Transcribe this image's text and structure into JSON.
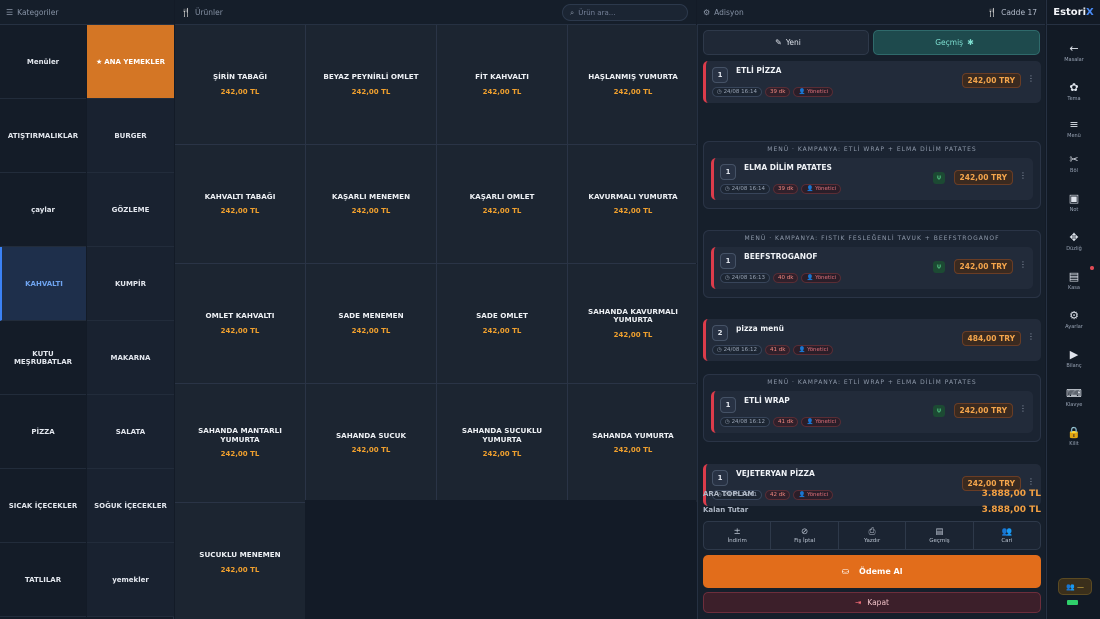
{
  "header": {
    "categories_title": "Kategoriler",
    "products_title": "Ürünler",
    "search_placeholder": "Ürün ara...",
    "cart_title": "Adisyon",
    "table_label": "Cadde 17"
  },
  "categories": [
    "Menüler",
    "ANA YEMEKLER",
    "ATIŞTIRMALIKLAR",
    "BURGER",
    "çaylar",
    "GÖZLEME",
    "KAHVALTI",
    "KUMPİR",
    "KUTU MEŞRUBATLAR",
    "MAKARNA",
    "PİZZA",
    "SALATA",
    "SICAK İÇECEKLER",
    "SOĞUK İÇECEKLER",
    "TATLILAR",
    "yemekler"
  ],
  "active_category": "KAHVALTI",
  "products": [
    {
      "name": "ŞİRİN TABAĞI",
      "price": "242,00 TL"
    },
    {
      "name": "BEYAZ PEYNİRLİ OMLET",
      "price": "242,00 TL"
    },
    {
      "name": "FİT KAHVALTI",
      "price": "242,00 TL"
    },
    {
      "name": "HAŞLANMIŞ YUMURTA",
      "price": "242,00 TL"
    },
    {
      "name": "KAHVALTI TABAĞI",
      "price": "242,00 TL"
    },
    {
      "name": "KAŞARLI MENEMEN",
      "price": "242,00 TL"
    },
    {
      "name": "KAŞARLI OMLET",
      "price": "242,00 TL"
    },
    {
      "name": "KAVURMALI YUMURTA",
      "price": "242,00 TL"
    },
    {
      "name": "OMLET KAHVALTI",
      "price": "242,00 TL"
    },
    {
      "name": "SADE MENEMEN",
      "price": "242,00 TL"
    },
    {
      "name": "SADE OMLET",
      "price": "242,00 TL"
    },
    {
      "name": "SAHANDA KAVURMALI YUMURTA",
      "price": "242,00 TL"
    },
    {
      "name": "SAHANDA MANTARLI YUMURTA",
      "price": "242,00 TL"
    },
    {
      "name": "SAHANDA SUCUK",
      "price": "242,00 TL"
    },
    {
      "name": "SAHANDA SUCUKLU YUMURTA",
      "price": "242,00 TL"
    },
    {
      "name": "SAHANDA YUMURTA",
      "price": "242,00 TL"
    },
    {
      "name": "SUCUKLU MENEMEN",
      "price": "242,00 TL"
    }
  ],
  "cart": {
    "new_label": "Yeni",
    "history_label": "Geçmiş",
    "items": [
      {
        "qty": "1",
        "name": "ETLİ PİZZA",
        "time": "24/08 16:14",
        "mins": "39 dk",
        "user": "Yönetici",
        "price": "242,00 TRY",
        "group": ""
      },
      {
        "qty": "1",
        "name": "ELMA DİLİM PATATES",
        "time": "24/08 16:14",
        "mins": "39 dk",
        "user": "Yönetici",
        "price": "242,00 TRY",
        "group": "MENÜ · KAMPANYA: ETLİ WRAP + ELMA DİLİM PATATES"
      },
      {
        "qty": "1",
        "name": "BEEFSTROGANOF",
        "time": "24/08 16:13",
        "mins": "40 dk",
        "user": "Yönetici",
        "price": "242,00 TRY",
        "group": "MENÜ · KAMPANYA: FISTIK FESLEĞENLİ TAVUK + BEEFSTROGANOF"
      },
      {
        "qty": "2",
        "name": "pizza menü",
        "time": "24/08 16:12",
        "mins": "41 dk",
        "user": "Yönetici",
        "price": "484,00 TRY",
        "group": ""
      },
      {
        "qty": "1",
        "name": "ETLİ WRAP",
        "time": "24/08 16:12",
        "mins": "41 dk",
        "user": "Yönetici",
        "price": "242,00 TRY",
        "group": "MENÜ · KAMPANYA: ETLİ WRAP + ELMA DİLİM PATATES"
      },
      {
        "qty": "1",
        "name": "VEJETERYAN PİZZA",
        "time": "24/08 16:11",
        "mins": "42 dk",
        "user": "Yönetici",
        "price": "242,00 TRY",
        "group": ""
      }
    ],
    "subtotal_label": "ARA TOPLAM",
    "subtotal": "3.888,00 TL",
    "remaining_label": "Kalan Tutar",
    "remaining": "3.888,00 TL",
    "actions": [
      "İndirim",
      "Fiş İptal",
      "Yazdır",
      "Geçmiş",
      "Cari"
    ],
    "pay_label": "Ödeme Al",
    "close_label": "Kapat"
  },
  "sidebar": {
    "brand_main": "Estori",
    "brand_accent": "X",
    "items": [
      "Masalar",
      "Tema",
      "Menü",
      "Böl",
      "Not",
      "Düzliğ",
      "Kasa",
      "Ayarlar",
      "Bilanç",
      "Klavye",
      "Kilit"
    ]
  },
  "colors": {
    "accent_orange": "#e26d1b",
    "price_orange": "#f0a02e",
    "active_blue": "#3b82f6",
    "danger_red": "#dc3c4b",
    "teal": "#1e4a4d"
  },
  "user_chip": "—"
}
